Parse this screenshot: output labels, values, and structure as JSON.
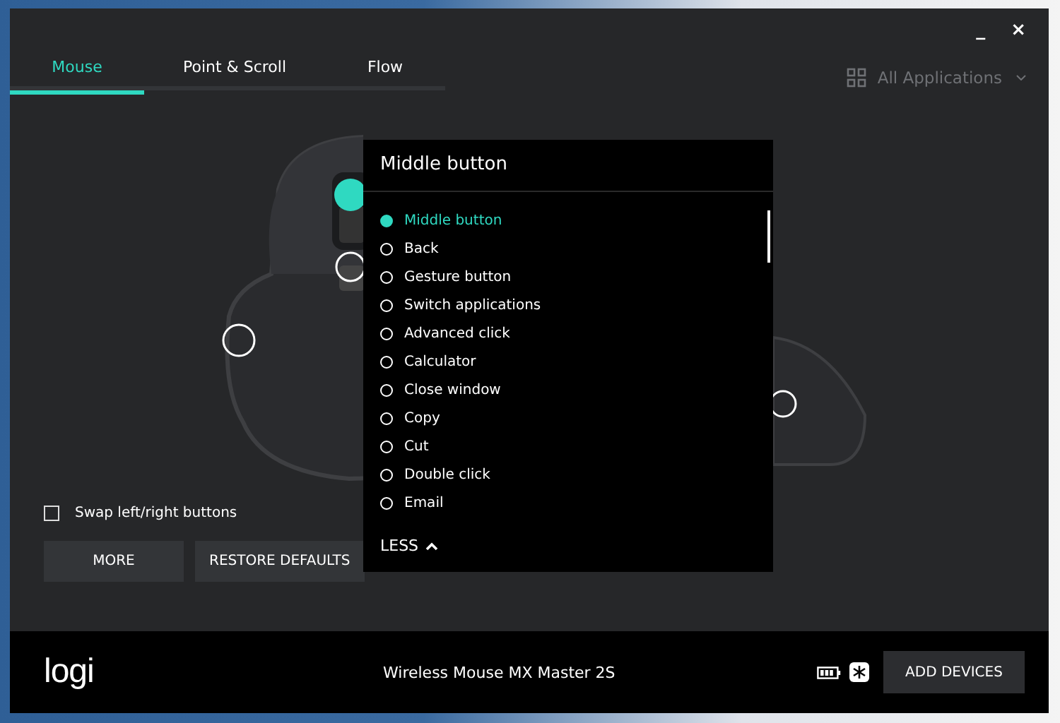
{
  "window": {
    "controls": [
      "_",
      "×"
    ]
  },
  "tabs": [
    {
      "label": "Mouse",
      "selected": true
    },
    {
      "label": "Point & Scroll",
      "selected": false
    },
    {
      "label": "Flow",
      "selected": false
    }
  ],
  "app_selector": {
    "label": "All Applications"
  },
  "swap_buttons": {
    "label": "Swap left/right buttons",
    "checked": false
  },
  "buttons": [
    "MORE",
    "RESTORE DEFAULTS"
  ],
  "dropdown": {
    "title": "Middle button",
    "toggle": "LESS",
    "options": [
      {
        "label": "Middle button",
        "selected": true
      },
      {
        "label": "Back",
        "selected": false
      },
      {
        "label": "Gesture button",
        "selected": false
      },
      {
        "label": "Switch applications",
        "selected": false
      },
      {
        "label": "Advanced click",
        "selected": false
      },
      {
        "label": "Calculator",
        "selected": false
      },
      {
        "label": "Close window",
        "selected": false
      },
      {
        "label": "Copy",
        "selected": false
      },
      {
        "label": "Cut",
        "selected": false
      },
      {
        "label": "Double click",
        "selected": false
      },
      {
        "label": "Email",
        "selected": false
      }
    ]
  },
  "footer": {
    "logo": "logi",
    "device": "Wireless Mouse MX Master 2S",
    "add_button": "ADD DEVICES"
  }
}
